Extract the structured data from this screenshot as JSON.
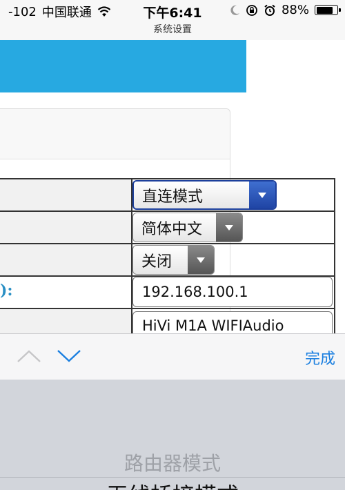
{
  "status_bar": {
    "signal": "-102",
    "carrier": "中国联通",
    "time": "下午6:41",
    "subtitle": "系统设置",
    "battery": "88%",
    "battery_level": 0.88
  },
  "form": {
    "mode_select": "直连模式",
    "language_select": "简体中文",
    "toggle_select": "关闭",
    "ip_label_fragment": "):",
    "ip_value": "192.168.100.1",
    "device_name_value": "HiVi M1A WIFIAudio"
  },
  "accessory": {
    "done_label": "完成"
  },
  "picker": {
    "items": [
      "路由器模式",
      "无线桥接模式"
    ]
  },
  "colors": {
    "banner": "#27a9e1",
    "accent": "#1a7fe0",
    "label_text": "#2a8fc4"
  }
}
